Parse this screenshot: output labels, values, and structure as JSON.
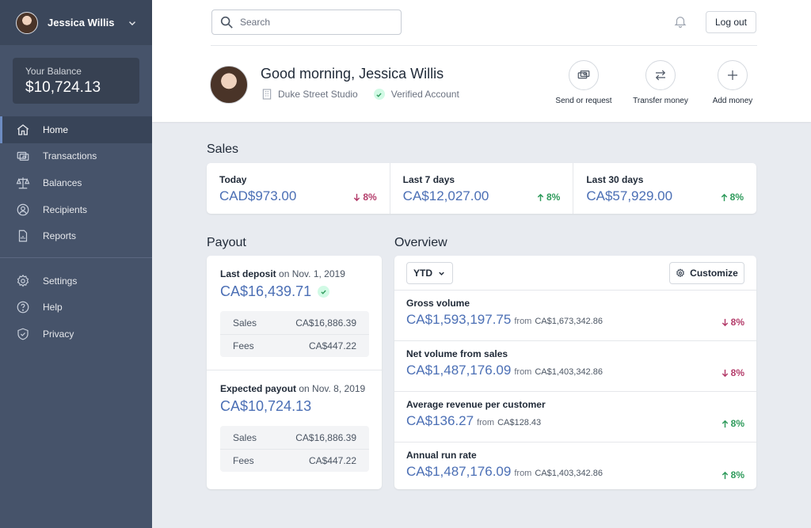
{
  "sidebar": {
    "user_name": "Jessica Willis",
    "balance_label": "Your Balance",
    "balance_value": "$10,724.13",
    "nav": [
      {
        "label": "Home",
        "icon": "home-icon",
        "active": true
      },
      {
        "label": "Transactions",
        "icon": "transactions-icon"
      },
      {
        "label": "Balances",
        "icon": "scale-icon"
      },
      {
        "label": "Recipients",
        "icon": "user-circle-icon"
      },
      {
        "label": "Reports",
        "icon": "document-report-icon"
      }
    ],
    "secondary_nav": [
      {
        "label": "Settings",
        "icon": "cog-icon"
      },
      {
        "label": "Help",
        "icon": "question-circle-icon"
      },
      {
        "label": "Privacy",
        "icon": "shield-check-icon"
      }
    ]
  },
  "header": {
    "search_placeholder": "Search",
    "logout_label": "Log out",
    "greeting": "Good morning, Jessica Willis",
    "company": "Duke Street Studio",
    "verified": "Verified Account",
    "actions": [
      {
        "label": "Send or request",
        "icon": "cash-icon"
      },
      {
        "label": "Transfer money",
        "icon": "switch-horizontal-icon"
      },
      {
        "label": "Add money",
        "icon": "plus-icon"
      }
    ]
  },
  "sales": {
    "title": "Sales",
    "cells": [
      {
        "label": "Today",
        "value": "CAD$973.00",
        "change": "8%",
        "direction": "down"
      },
      {
        "label": "Last 7 days",
        "value": "CA$12,027.00",
        "change": "8%",
        "direction": "up"
      },
      {
        "label": "Last 30 days",
        "value": "CA$57,929.00",
        "change": "8%",
        "direction": "up"
      }
    ]
  },
  "payout": {
    "title": "Payout",
    "blocks": [
      {
        "head": "Last deposit",
        "date": "on Nov. 1, 2019",
        "amount": "CA$16,439.71",
        "verified": true,
        "rows": [
          {
            "label": "Sales",
            "value": "CA$16,886.39"
          },
          {
            "label": "Fees",
            "value": "CA$447.22"
          }
        ]
      },
      {
        "head": "Expected payout",
        "date": "on Nov. 8, 2019",
        "amount": "CA$10,724.13",
        "verified": false,
        "rows": [
          {
            "label": "Sales",
            "value": "CA$16,886.39"
          },
          {
            "label": "Fees",
            "value": "CA$447.22"
          }
        ]
      }
    ]
  },
  "overview": {
    "title": "Overview",
    "period": "YTD",
    "customize_label": "Customize",
    "from_label": "from",
    "rows": [
      {
        "label": "Gross volume",
        "value": "CA$1,593,197.75",
        "previous": "CA$1,673,342.86",
        "change": "8%",
        "direction": "down"
      },
      {
        "label": "Net volume from sales",
        "value": "CA$1,487,176.09",
        "previous": "CA$1,403,342.86",
        "change": "8%",
        "direction": "down"
      },
      {
        "label": "Average revenue per customer",
        "value": "CA$136.27",
        "previous": "CA$128.43",
        "change": "8%",
        "direction": "up"
      },
      {
        "label": "Annual run rate",
        "value": "CA$1,487,176.09",
        "previous": "CA$1,403,342.86",
        "change": "8%",
        "direction": "up"
      }
    ]
  },
  "colors": {
    "accent": "#4b6fb5",
    "up": "#2f9b5c",
    "down": "#b43d6b",
    "sidebar": "#46536a"
  }
}
